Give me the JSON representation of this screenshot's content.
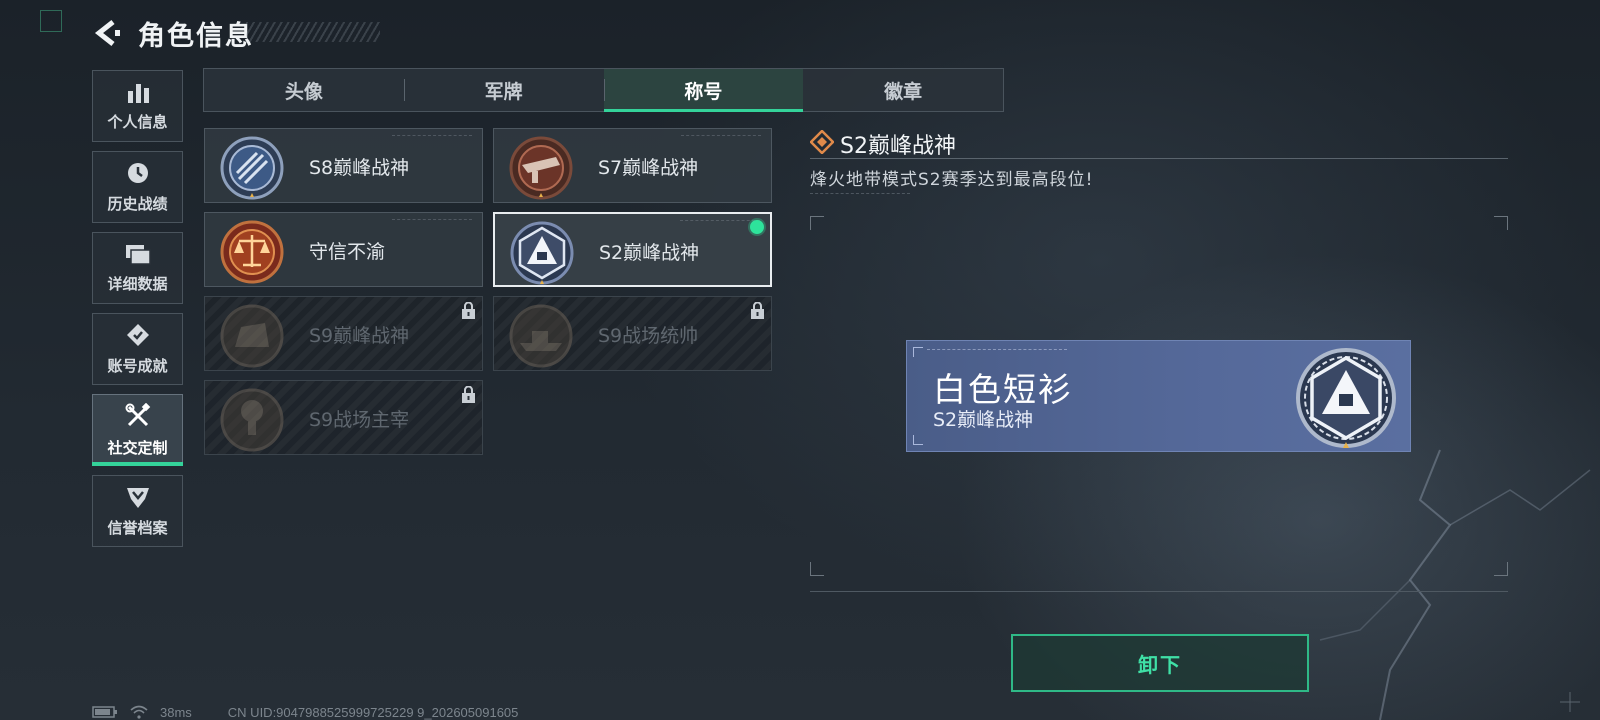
{
  "header": {
    "title": "角色信息"
  },
  "nav": {
    "items": [
      {
        "label": "个人信息",
        "icon": "bar-chart-icon"
      },
      {
        "label": "历史战绩",
        "icon": "clock-icon"
      },
      {
        "label": "详细数据",
        "icon": "folders-icon"
      },
      {
        "label": "账号成就",
        "icon": "achievement-icon"
      },
      {
        "label": "社交定制",
        "icon": "tools-icon",
        "active": true
      },
      {
        "label": "信誉档案",
        "icon": "shield-badge-icon"
      }
    ]
  },
  "tabs": [
    {
      "label": "头像"
    },
    {
      "label": "军牌"
    },
    {
      "label": "称号",
      "active": true
    },
    {
      "label": "徽章"
    }
  ],
  "titles": [
    {
      "label": "S8巅峰战神",
      "icon": "s8-medal-icon",
      "locked": false,
      "selected": false
    },
    {
      "label": "S7巅峰战神",
      "icon": "s7-medal-icon",
      "locked": false,
      "selected": false
    },
    {
      "label": "守信不渝",
      "icon": "scales-medal-icon",
      "locked": false,
      "selected": false
    },
    {
      "label": "S2巅峰战神",
      "icon": "s2-medal-icon",
      "locked": false,
      "selected": true,
      "equipped": true
    },
    {
      "label": "S9巅峰战神",
      "icon": "s9-medal-icon",
      "locked": true
    },
    {
      "label": "S9战场统帅",
      "icon": "warship-medal-icon",
      "locked": true
    },
    {
      "label": "S9战场主宰",
      "icon": "explosion-medal-icon",
      "locked": true
    }
  ],
  "detail": {
    "title": "S2巅峰战神",
    "description": "烽火地带模式S2赛季达到最高段位!"
  },
  "nameplate": {
    "name": "白色短衫",
    "title": "S2巅峰战神"
  },
  "actions": {
    "unequip_label": "卸下"
  },
  "status": {
    "ping": "38ms",
    "uid": "CN UID:9047988525999725229 9_202605091605"
  },
  "colors": {
    "accent": "#34d39a",
    "nameplate": "#55699a",
    "equipped": "#2ee39b"
  }
}
